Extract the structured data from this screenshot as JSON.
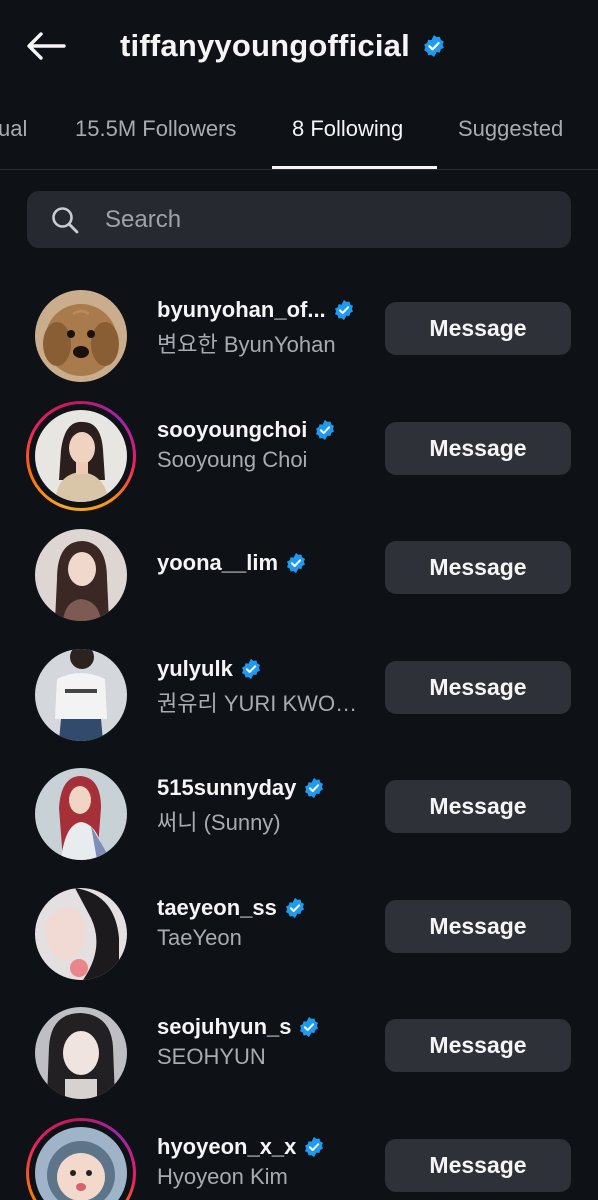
{
  "header": {
    "back_icon": "arrow-left-icon",
    "title": "tiffanyyoungofficial",
    "verified": true
  },
  "tabs": [
    {
      "label": "ual",
      "active": false
    },
    {
      "label": "15.5M Followers",
      "active": false
    },
    {
      "label": "8 Following",
      "active": true
    },
    {
      "label": "Suggested",
      "active": false
    }
  ],
  "search": {
    "icon": "search-icon",
    "placeholder": "Search",
    "value": ""
  },
  "colors": {
    "background": "#0e1116",
    "button": "#2e3238",
    "verified": "#1d9bf0",
    "secondary_text": "#a8abb2"
  },
  "following": [
    {
      "username": "byunyohan_of...",
      "full_name": "변요한 ByunYohan",
      "verified": true,
      "story_ring": false,
      "button": "Message"
    },
    {
      "username": "sooyoungchoi",
      "full_name": "Sooyoung Choi",
      "verified": true,
      "story_ring": true,
      "button": "Message"
    },
    {
      "username": "yoona__lim",
      "full_name": "",
      "verified": true,
      "story_ring": false,
      "button": "Message"
    },
    {
      "username": "yulyulk",
      "full_name": "권유리 YURI KWON...",
      "verified": true,
      "story_ring": false,
      "button": "Message"
    },
    {
      "username": "515sunnyday",
      "full_name": "써니 (Sunny)",
      "verified": true,
      "story_ring": false,
      "button": "Message"
    },
    {
      "username": "taeyeon_ss",
      "full_name": "TaeYeon",
      "verified": true,
      "story_ring": false,
      "button": "Message"
    },
    {
      "username": "seojuhyun_s",
      "full_name": "SEOHYUN",
      "verified": true,
      "story_ring": false,
      "button": "Message"
    },
    {
      "username": "hyoyeon_x_x",
      "full_name": "Hyoyeon Kim",
      "verified": true,
      "story_ring": true,
      "button": "Message"
    }
  ]
}
